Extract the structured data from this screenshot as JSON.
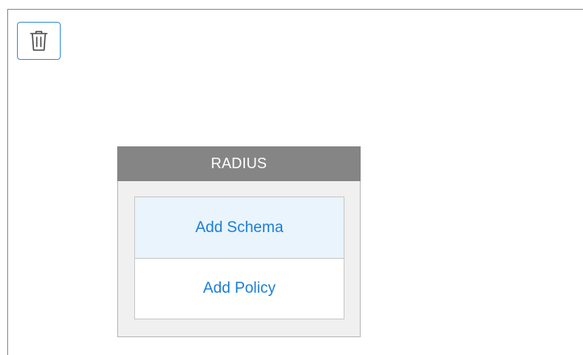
{
  "toolbar": {
    "delete_icon": "trash-icon",
    "accent_color": "#3d8fd6"
  },
  "card": {
    "title": "RADIUS",
    "header_color": "#858585",
    "items": [
      {
        "label": "Add Schema",
        "highlighted": true
      },
      {
        "label": "Add Policy",
        "highlighted": false
      }
    ],
    "link_color": "#1c7ed6"
  }
}
